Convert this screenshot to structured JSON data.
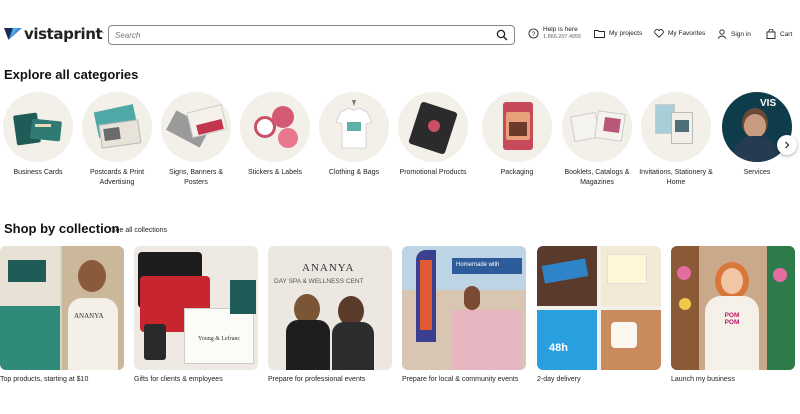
{
  "header": {
    "logo": "vistaprint",
    "logo_mark": ".",
    "search_placeholder": "Search",
    "help_title": "Help is here",
    "help_phone": "1.866.207.4955",
    "my_projects": "My projects",
    "my_favorites": "My Favorites",
    "sign_in": "Sign in",
    "cart": "Cart"
  },
  "categories": {
    "title": "Explore all categories",
    "items": [
      {
        "label": "Business Cards",
        "icon": "business-cards-image"
      },
      {
        "label": "Postcards & Print Advertising",
        "icon": "postcards-image"
      },
      {
        "label": "Signs, Banners & Posters",
        "icon": "signs-image"
      },
      {
        "label": "Stickers & Labels",
        "icon": "stickers-image"
      },
      {
        "label": "Clothing & Bags",
        "icon": "clothing-image"
      },
      {
        "label": "Promotional Products",
        "icon": "promotional-image"
      },
      {
        "label": "Packaging",
        "icon": "packaging-image"
      },
      {
        "label": "Booklets, Catalogs & Magazines",
        "icon": "booklets-image"
      },
      {
        "label": "Invitations, Stationery & Home",
        "icon": "invitations-image"
      },
      {
        "label": "Services",
        "icon": "services-image"
      }
    ]
  },
  "collections": {
    "title": "Shop by collection",
    "see_all": "See all collections",
    "items": [
      {
        "label": "Top products, starting at $10",
        "sign": "ANANYA"
      },
      {
        "label": "Gifts for clients & employees",
        "sign": "Young & Lefranc"
      },
      {
        "label": "Prepare for professional events",
        "sign": "ANANYA",
        "sub": "DAY SPA & WELLNESS CENT"
      },
      {
        "label": "Prepare for local & community events",
        "sign": "Homemade with"
      },
      {
        "label": "2-day delivery",
        "sign": "48h"
      },
      {
        "label": "Launch my business",
        "sign": "POM POM"
      }
    ]
  },
  "colors": {
    "brand_blue": "#1b77d2",
    "brand_dark": "#1a2b5a",
    "circle_bg": "#f3efe9"
  }
}
